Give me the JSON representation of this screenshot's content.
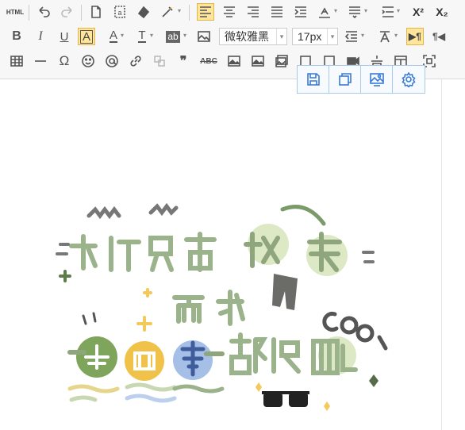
{
  "toolbar": {
    "row1": {
      "source_label": "HTML",
      "icons": [
        "undo-icon",
        "redo-icon",
        "new-document-icon",
        "paste-text-icon",
        "clear-format-icon",
        "format-painter-icon",
        "align-left-icon",
        "align-center-icon",
        "align-right-icon",
        "align-justify-icon",
        "indent-icon",
        "line-height-icon",
        "paragraph-spacing-icon",
        "list-icon",
        "superscript-icon",
        "subscript-icon"
      ],
      "superscript_label": "X²",
      "subscript_label": "X₂"
    },
    "row2": {
      "bold_label": "B",
      "italic_label": "I",
      "underline_label": "U",
      "font_border_label": "A",
      "font_color_label": "A",
      "text_style_label": "T",
      "highlight_label": "ab",
      "font_family_value": "微软雅黑",
      "font_size_value": "17px",
      "ltr_label": "▶¶",
      "rtl_label": "¶◀"
    },
    "row3": {
      "icons": [
        "table-icon",
        "horizontal-rule-icon",
        "special-char-icon",
        "emoji-icon",
        "at-sign-icon",
        "link-icon",
        "unlink-icon",
        "blockquote-icon",
        "spellcheck-icon",
        "image-icon",
        "image-gallery-icon",
        "insert-frame-icon",
        "attachment-icon",
        "video-icon",
        "pagebreak-icon",
        "template-icon",
        "fullscreen-icon"
      ],
      "omega_label": "Ω",
      "quote_label": "❞",
      "abc_label": "ABC"
    }
  },
  "image_popup": {
    "icons": [
      "save-icon",
      "copy-icon",
      "image-edit-icon",
      "settings-icon"
    ]
  },
  "accent_color": "#3a7bd5",
  "active_color": "#ffe69b"
}
